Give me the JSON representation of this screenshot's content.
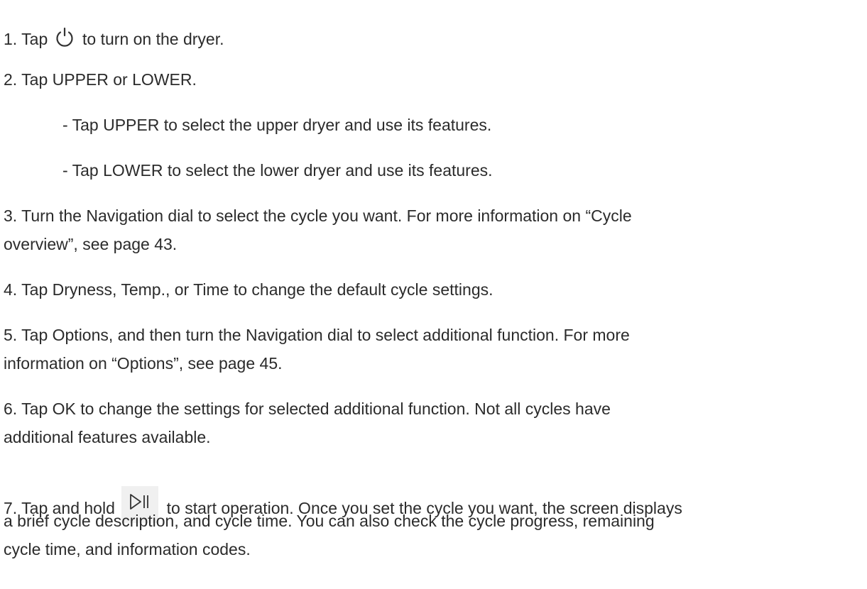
{
  "steps": {
    "s1": {
      "before": "1. Tap",
      "icon": "power-icon",
      "after": "to turn on the dryer."
    },
    "s2": {
      "text": "2. Tap UPPER or LOWER."
    },
    "s2a": {
      "text": "- Tap UPPER to select the upper dryer and use its features."
    },
    "s2b": {
      "text": "- Tap LOWER to select the lower dryer and use its features."
    },
    "s3": {
      "line1": "3. Turn the Navigation dial to select the cycle you want. For more information on “Cycle",
      "line2": "overview”, see page 43."
    },
    "s4": {
      "text": "4. Tap Dryness, Temp., or Time to change the default cycle settings."
    },
    "s5": {
      "line1": "5. Tap Options, and then turn the Navigation dial to select additional function. For more",
      "line2": "information on “Options”, see page 45."
    },
    "s6": {
      "line1": "6. Tap OK to change the settings for selected additional function. Not all cycles have",
      "line2": "additional features available."
    },
    "s7": {
      "before": "7. Tap and hold",
      "icon": "play-pause-icon",
      "after": "to start operation. Once you set the cycle you want, the screen displays",
      "line2": "a brief cycle description, and cycle time. You can also check the cycle progress, remaining",
      "line3": "cycle time, and information codes."
    }
  }
}
